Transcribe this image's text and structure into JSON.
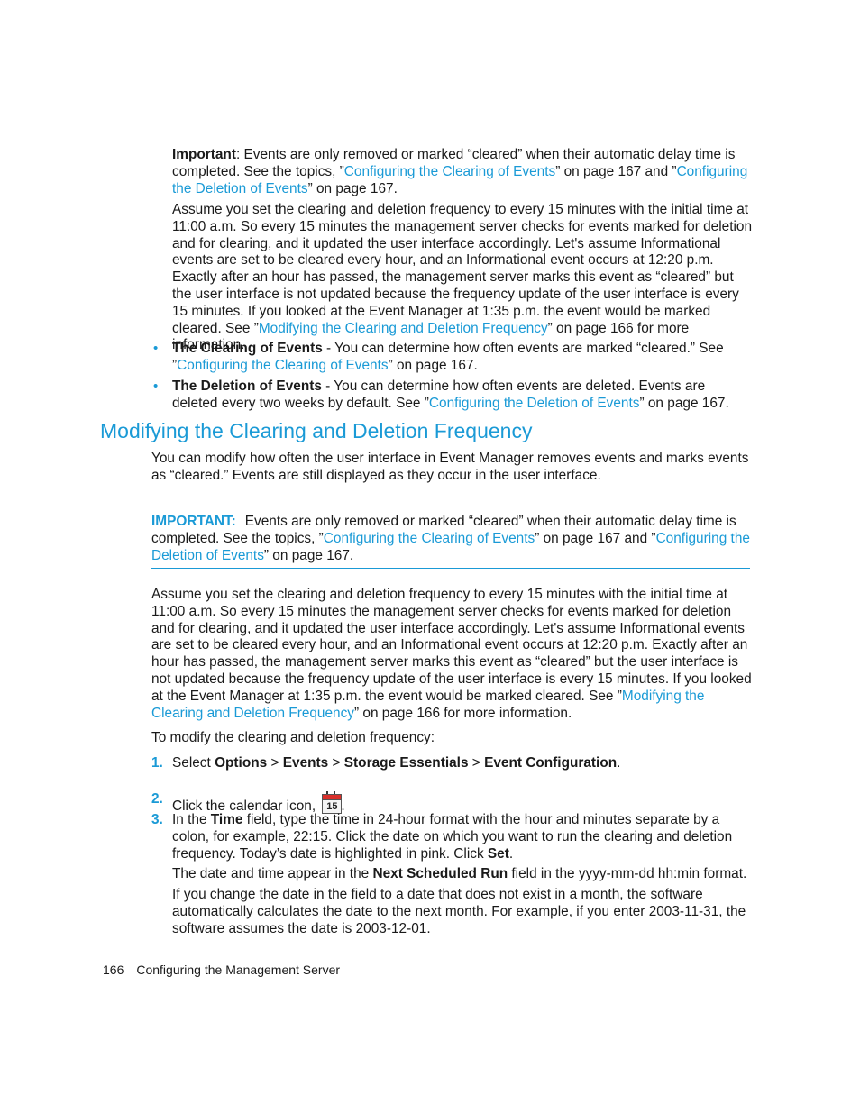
{
  "top_important": {
    "label": "Important",
    "text1": ": Events are only removed or marked “cleared” when their automatic delay time is completed. See the topics, ”",
    "link1": "Configuring the Clearing of Events",
    "text2": "” on page 167 and ”",
    "link2": "Configuring the Deletion of Events",
    "text3": "” on page 167."
  },
  "top_assume": {
    "text1": "Assume you set the clearing and deletion frequency to every 15 minutes with the initial time at 11:00 a.m. So every 15 minutes the management server checks for events marked for deletion and for clearing, and it updated the user interface accordingly. Let's assume Informational events are set to be cleared every hour, and an Informational event occurs at 12:20 p.m. Exactly after an hour has passed, the management server marks this event as “cleared” but the user interface is not updated because the frequency update of the user interface is every 15 minutes. If you looked at the Event Manager at 1:35 p.m. the event would be marked cleared. See ”",
    "link": "Modifying the Clearing and Deletion Frequency",
    "text2": "” on page 166 for more information."
  },
  "bullets": [
    {
      "bullet": "•",
      "title": "The Clearing of Events",
      "text1": " - You can determine how often events are marked “cleared.” See ”",
      "link": "Configuring the Clearing of Events",
      "text2": "” on page 167."
    },
    {
      "bullet": "•",
      "title": "The Deletion of Events",
      "text1": " - You can determine how often events are deleted. Events are deleted every two weeks by default. See ”",
      "link": "Configuring the Deletion of Events",
      "text2": "” on page 167."
    }
  ],
  "section": {
    "heading": "Modifying the Clearing and Deletion Frequency",
    "intro": "You can modify how often the user interface in Event Manager removes events and marks events as “cleared.” Events are still displayed as they occur in the user interface."
  },
  "important_box": {
    "label": "IMPORTANT:",
    "text1": "Events are only removed or marked “cleared” when their automatic delay time is completed. See the topics, ”",
    "link1": "Configuring the Clearing of Events",
    "text2": "” on page 167 and ”",
    "link2": "Configuring the Deletion of Events",
    "text3": "” on page 167."
  },
  "main_assume": {
    "text1": "Assume you set the clearing and deletion frequency to every 15 minutes with the initial time at 11:00 a.m. So every 15 minutes the management server checks for events marked for deletion and for clearing, and it updated the user interface accordingly. Let's assume Informational events are set to be cleared every hour, and an Informational event occurs at 12:20 p.m. Exactly after an hour has passed, the management server marks this event as “cleared” but the user interface is not updated because the frequency update of the user interface is every 15 minutes. If you looked at the Event Manager at 1:35 p.m. the event would be marked cleared. See ”",
    "link": "Modifying the Clearing and Deletion Frequency",
    "text2": "” on page 166 for more information."
  },
  "procedure_intro": "To modify the clearing and deletion frequency:",
  "steps": [
    {
      "num": "1.",
      "pre": "Select ",
      "b1": "Options",
      "s1": " > ",
      "b2": "Events",
      "s2": " > ",
      "b3": "Storage Essentials",
      "s3": " > ",
      "b4": "Event Configuration",
      "end": "."
    },
    {
      "num": "2.",
      "pre": "Click the calendar icon, ",
      "icon_day": "15",
      "end": "."
    },
    {
      "num": "3.",
      "pre": "In the ",
      "b1": "Time",
      "mid": " field, type the time in 24-hour format with the hour and minutes separate by a colon, for example, 22:15. Click the date on which you want to run the clearing and deletion frequency. Today’s date is highlighted in pink. Click ",
      "b2": "Set",
      "end": ".",
      "para2_pre": "The date and time appear in the ",
      "para2_bold": "Next Scheduled Run",
      "para2_end": " field in the yyyy-mm-dd hh:min format.",
      "para3": "If you change the date in the field to a date that does not exist in a month, the software automatically calculates the date to the next month. For example, if you enter 2003-11-31, the software assumes the date is 2003-12-01."
    }
  ],
  "footer": {
    "page_number": "166",
    "chapter": "Configuring the Management Server"
  }
}
